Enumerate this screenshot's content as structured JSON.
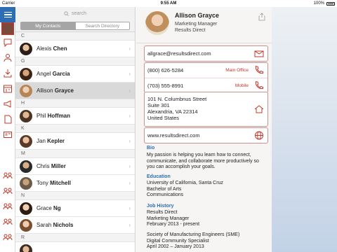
{
  "status_bar": {
    "carrier": "Carrier",
    "time": "9:55 AM",
    "battery": "100%"
  },
  "rail": {
    "icons": [
      "menu-icon",
      "chat-icon",
      "contacts-icon",
      "download-icon",
      "calendar-icon",
      "megaphone-icon",
      "document-icon",
      "id-card-icon",
      "group-icon"
    ]
  },
  "search": {
    "placeholder": "search"
  },
  "segments": {
    "my_contacts": "My Contacts",
    "search_directory": "Search Directory"
  },
  "contacts": {
    "sections": [
      {
        "letter": "C",
        "people": [
          {
            "first": "Alexis",
            "last": "Chen"
          }
        ]
      },
      {
        "letter": "G",
        "people": [
          {
            "first": "Angel",
            "last": "Garcia"
          },
          {
            "first": "Allison",
            "last": "Grayce",
            "selected": true
          }
        ]
      },
      {
        "letter": "H",
        "people": [
          {
            "first": "Phil",
            "last": "Hoffman"
          }
        ]
      },
      {
        "letter": "K",
        "people": [
          {
            "first": "Jan",
            "last": "Kepler"
          }
        ]
      },
      {
        "letter": "M",
        "people": [
          {
            "first": "Chris",
            "last": "Miller"
          },
          {
            "first": "Tony",
            "last": "Mitchell"
          }
        ]
      },
      {
        "letter": "N",
        "people": [
          {
            "first": "Grace",
            "last": "Ng"
          },
          {
            "first": "Sarah",
            "last": "Nichols"
          }
        ]
      },
      {
        "letter": "R",
        "people": []
      }
    ]
  },
  "detail": {
    "name": "Allison Grayce",
    "title": "Marketing Manager",
    "company": "Results Direct",
    "email": "allgrace@resultsdirect.com",
    "phones": [
      {
        "number": "(800) 626-5284",
        "label": "Main Office"
      },
      {
        "number": "(703) 555-8991",
        "label": "Mobile"
      }
    ],
    "address": {
      "line1": "101 N. Columbnus Street",
      "line2": "Suite 301",
      "line3": "Alexandria, VA 22314",
      "line4": "United States"
    },
    "website": "www.resultsdirect.com",
    "bio_label": "Bio",
    "bio": "My passion is helping you learn how to connect, communicate, and collaborate more productively so you can accomplish your goals.",
    "education_label": "Education",
    "education": {
      "line1": "University of California, Santa Cruz",
      "line2": "Bachelor of Arts",
      "line3": "Communications"
    },
    "job_label": "Job History",
    "job1": {
      "line1": "Results Direct",
      "line2": "Marketing Manager",
      "line3": "February 2013 - present"
    },
    "job2": {
      "line1": "Society of Manufacturing Engineers (SME)",
      "line2": "Digital Community Specialist",
      "line3": "April 2002 – January 2013"
    }
  },
  "colors": {
    "accent": "#2d6db5",
    "card_border": "#c9908f",
    "label_red": "#c0392b"
  }
}
